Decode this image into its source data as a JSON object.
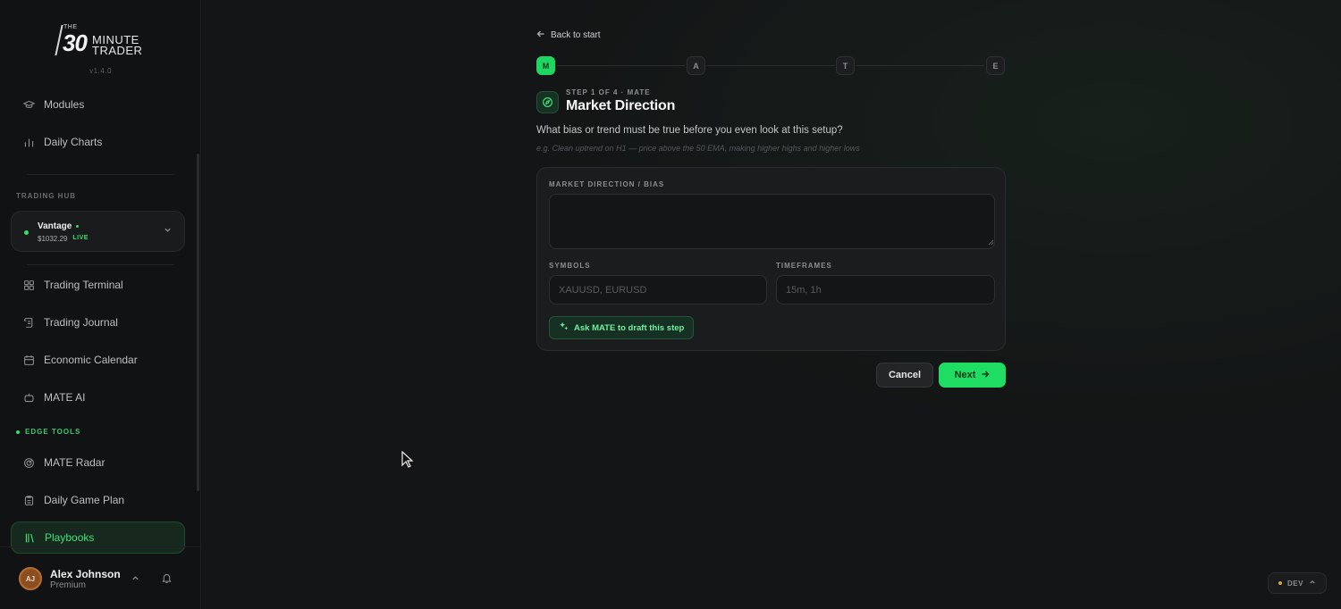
{
  "brand": {
    "logo_the": "THE",
    "logo_number": "30",
    "logo_word1": "MINUTE",
    "logo_word2": "TRADER",
    "version": "v1.4.0"
  },
  "sidebar": {
    "top_items": [
      {
        "label": "Modules",
        "icon": "graduation-cap-icon"
      },
      {
        "label": "Daily Charts",
        "icon": "bar-chart-icon"
      }
    ],
    "trading_hub_label": "TRADING HUB",
    "account": {
      "name": "Vantage",
      "balance": "$1032.29",
      "status": "LIVE"
    },
    "hub_items": [
      {
        "label": "Trading Terminal",
        "icon": "grid-icon"
      },
      {
        "label": "Trading Journal",
        "icon": "scroll-icon"
      },
      {
        "label": "Economic Calendar",
        "icon": "calendar-icon"
      },
      {
        "label": "MATE AI",
        "icon": "bot-icon"
      }
    ],
    "edge_tools_label": "EDGE TOOLS",
    "edge_items": [
      {
        "label": "MATE Radar",
        "icon": "radar-icon"
      },
      {
        "label": "Daily Game Plan",
        "icon": "clipboard-icon"
      },
      {
        "label": "Playbooks",
        "icon": "library-icon",
        "active": true
      }
    ],
    "user": {
      "initials": "AJ",
      "name": "Alex Johnson",
      "plan": "Premium"
    }
  },
  "main": {
    "back_label": "Back to start",
    "steps": [
      "M",
      "A",
      "T",
      "E"
    ],
    "active_step": 0,
    "step_meta": "STEP 1 OF 4 · MATE",
    "step_title": "Market Direction",
    "question": "What bias or trend must be true before you even look at this setup?",
    "example": "e.g. Clean uptrend on H1 — price above the 50 EMA, making higher highs and higher lows",
    "form": {
      "direction_label": "MARKET DIRECTION / BIAS",
      "direction_value": "",
      "symbols_label": "SYMBOLS",
      "symbols_placeholder": "XAUUSD, EURUSD",
      "timeframes_label": "TIMEFRAMES",
      "timeframes_placeholder": "15m, 1h",
      "ask_label": "Ask MATE to draft this step"
    },
    "cancel_label": "Cancel",
    "next_label": "Next"
  },
  "dev_badge": "DEV",
  "colors": {
    "accent": "#1fdc63",
    "background": "#141516",
    "sidebar": "#111213"
  }
}
